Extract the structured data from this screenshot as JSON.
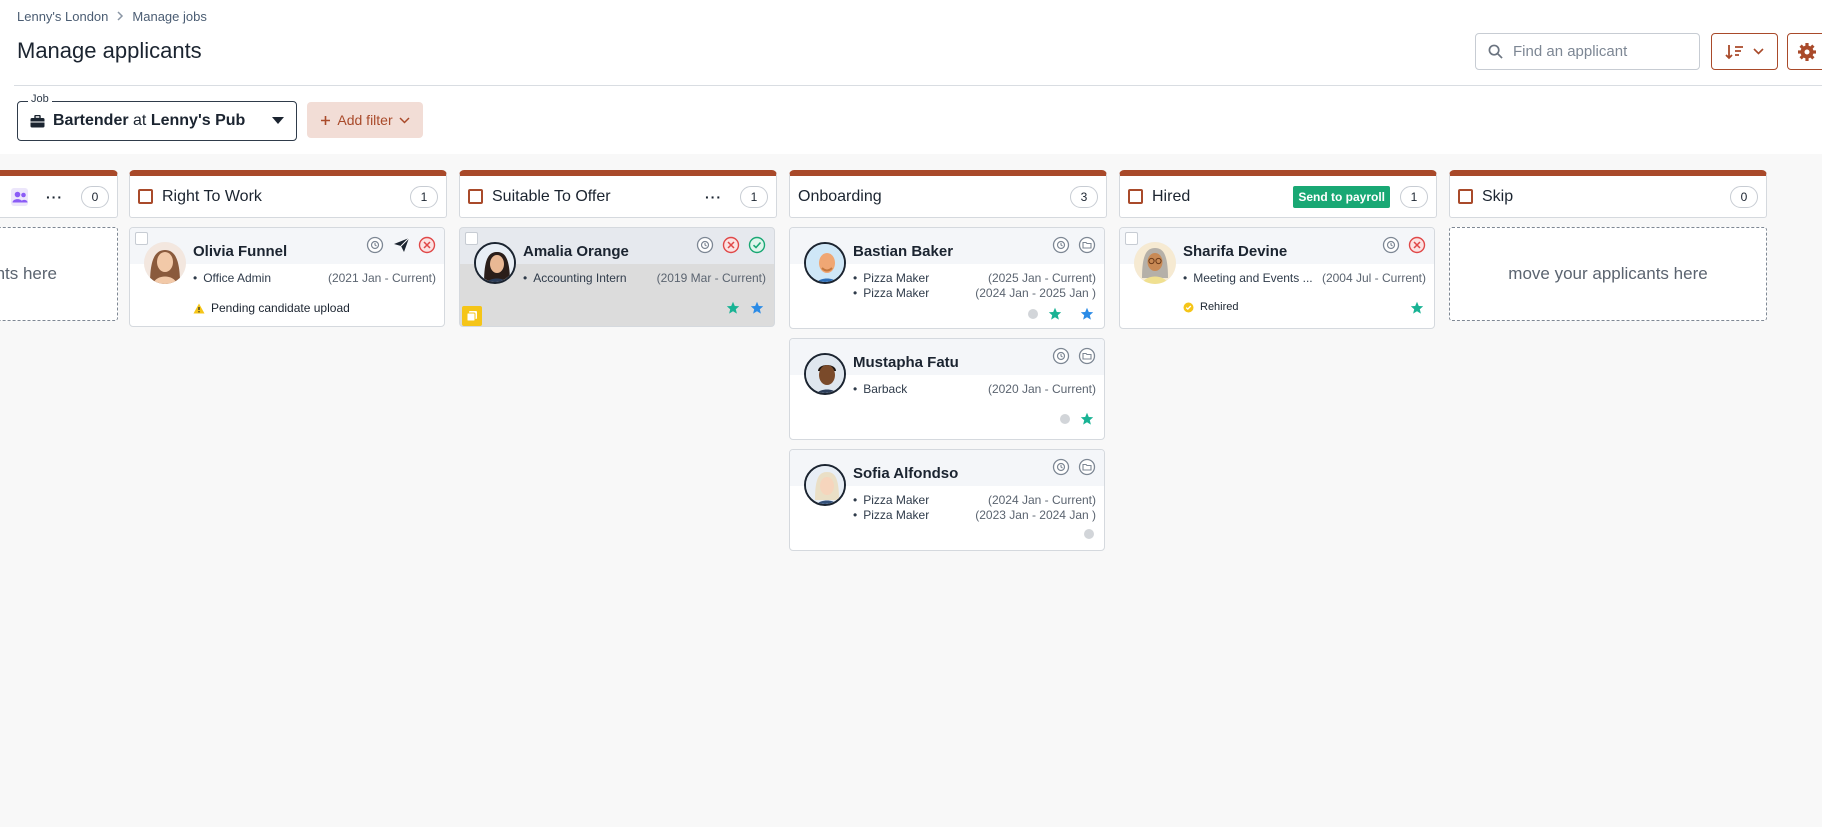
{
  "breadcrumb": {
    "root": "Lenny's London",
    "current": "Manage jobs"
  },
  "page": {
    "title": "Manage applicants"
  },
  "search": {
    "placeholder": "Find an applicant"
  },
  "job_filter": {
    "legend": "Job",
    "role": "Bartender",
    "connector": "at",
    "venue": "Lenny's Pub"
  },
  "add_filter": {
    "label": "Add filter"
  },
  "colors": {
    "accent": "#a94a2a",
    "payroll": "#19a874",
    "star_teal": "#19b394",
    "star_blue": "#2b8be6"
  },
  "columns": [
    {
      "title": "",
      "count": "0",
      "dropzone": "move your applicants here"
    },
    {
      "title": "Right To Work",
      "count": "1"
    },
    {
      "title": "Suitable To Offer",
      "count": "1"
    },
    {
      "title": "Onboarding",
      "count": "3"
    },
    {
      "title": "Hired",
      "count": "1",
      "action": "Send to payroll"
    },
    {
      "title": "Skip",
      "count": "0",
      "dropzone": "move your applicants here"
    }
  ],
  "first_dropzone_visible": "nts here",
  "cards": {
    "olivia": {
      "name": "Olivia Funnel",
      "role": "Office Admin",
      "dates": "(2021 Jan - Current)",
      "status": "Pending candidate upload"
    },
    "amalia": {
      "name": "Amalia Orange",
      "role": "Accounting Intern",
      "dates": "(2019 Mar - Current)"
    },
    "bastian": {
      "name": "Bastian Baker",
      "roles": [
        {
          "role": "Pizza Maker",
          "dates": "(2025 Jan - Current)"
        },
        {
          "role": "Pizza Maker",
          "dates": "(2024 Jan - 2025 Jan )"
        }
      ]
    },
    "mustapha": {
      "name": "Mustapha Fatu",
      "role": "Barback",
      "dates": "(2020 Jan - Current)"
    },
    "sofia": {
      "name": "Sofia Alfondso",
      "roles": [
        {
          "role": "Pizza Maker",
          "dates": "(2024 Jan - Current)"
        },
        {
          "role": "Pizza Maker",
          "dates": "(2023 Jan - 2024 Jan )"
        }
      ]
    },
    "sharifa": {
      "name": "Sharifa Devine",
      "role": "Meeting and Events ...",
      "dates": "(2004 Jul - Current)",
      "status": "Rehired"
    }
  }
}
